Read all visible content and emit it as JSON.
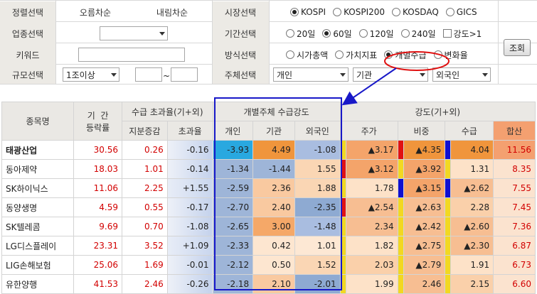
{
  "form": {
    "row1": {
      "label": "정렬선택",
      "sort_asc": "오름차순",
      "sort_desc": "내림차순",
      "market_label": "시장선택",
      "market_options": [
        "KOSPI",
        "KOSPI200",
        "KOSDAQ",
        "GICS"
      ],
      "market_selected": "KOSPI"
    },
    "row2": {
      "label": "업종선택",
      "industry_value": "",
      "period_label": "기간선택",
      "period_options": [
        "20일",
        "60일",
        "120일",
        "240일"
      ],
      "period_selected": "60일",
      "strength_checkbox": "강도>1"
    },
    "row3": {
      "label": "키워드",
      "keyword_value": "",
      "method_label": "방식선택",
      "method_options": [
        "시가총액",
        "가치지표",
        "개별수급",
        "변화율"
      ],
      "method_selected": "개별수급"
    },
    "row4": {
      "label": "규모선택",
      "size_value": "1조이상",
      "range_sep": "~",
      "subject_label": "주체선택",
      "subject_values": [
        "개인",
        "기관",
        "외국인"
      ]
    },
    "search_button": "조회"
  },
  "table": {
    "headers": {
      "name": "종목명",
      "period_return_1": "기  간",
      "period_return_2": "등락률",
      "excess_group": "수급 초과율(기+외)",
      "stake_change": "지분증감",
      "excess_rate": "초과율",
      "subject_group": "개별주체 수급강도",
      "individual": "개인",
      "institution": "기관",
      "foreign": "외국인",
      "strength_group": "강도(기+외)",
      "price": "주가",
      "weight": "비중",
      "supply": "수급",
      "total": "합산"
    },
    "rows": [
      {
        "name": "태광산업",
        "ret": "30.56",
        "stake": "0.26",
        "excess": "-0.16",
        "ind": "-3.93",
        "inst": "4.49",
        "frn": "-1.08",
        "price": "▲3.17",
        "weight": "▲4.35",
        "supply": "4.04",
        "total": "11.56"
      },
      {
        "name": "동아제약",
        "ret": "18.03",
        "stake": "1.01",
        "excess": "-0.14",
        "ind": "-1.34",
        "inst": "-1.44",
        "frn": "1.55",
        "price": "▲3.12",
        "weight": "▲3.92",
        "supply": "1.31",
        "total": "8.35"
      },
      {
        "name": "SK하이닉스",
        "ret": "11.06",
        "stake": "2.25",
        "excess": "+1.55",
        "ind": "-2.59",
        "inst": "2.36",
        "frn": "1.88",
        "price": "1.78",
        "weight": "▲3.15",
        "supply": "▲2.62",
        "total": "7.55"
      },
      {
        "name": "동양생명",
        "ret": "4.59",
        "stake": "0.55",
        "excess": "-0.17",
        "ind": "-2.70",
        "inst": "2.40",
        "frn": "-2.35",
        "price": "▲2.54",
        "weight": "▲2.63",
        "supply": "2.28",
        "total": "7.45"
      },
      {
        "name": "SK텔레콤",
        "ret": "9.69",
        "stake": "0.70",
        "excess": "-1.08",
        "ind": "-2.65",
        "inst": "3.00",
        "frn": "-1.48",
        "price": "2.34",
        "weight": "▲2.42",
        "supply": "▲2.60",
        "total": "7.36"
      },
      {
        "name": "LG디스플레이",
        "ret": "23.31",
        "stake": "3.52",
        "excess": "+1.09",
        "ind": "-2.33",
        "inst": "0.42",
        "frn": "1.01",
        "price": "1.82",
        "weight": "▲2.75",
        "supply": "▲2.30",
        "total": "6.87"
      },
      {
        "name": "LIG손해보험",
        "ret": "25.06",
        "stake": "1.69",
        "excess": "-0.01",
        "ind": "-2.12",
        "inst": "0.50",
        "frn": "1.52",
        "price": "2.03",
        "weight": "▲2.79",
        "supply": "1.91",
        "total": "6.73"
      },
      {
        "name": "유한양행",
        "ret": "41.53",
        "stake": "2.46",
        "excess": "-0.26",
        "ind": "-2.18",
        "inst": "2.10",
        "frn": "-2.01",
        "price": "1.99",
        "weight": "2.46",
        "supply": "2.15",
        "total": "6.60"
      }
    ]
  },
  "colors": {
    "label_bg": "#eceae5",
    "annotation_blue": "#1818c8",
    "annotation_red": "#e01010",
    "value_red": "#d20000"
  }
}
